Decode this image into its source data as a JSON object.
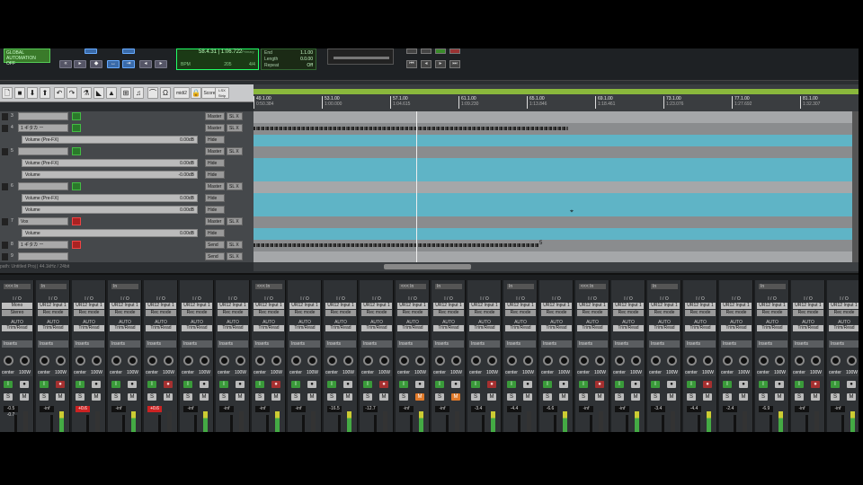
{
  "transport": {
    "automation_label": "GLOBAL AUTOMATION",
    "automation_state": "OFF",
    "counter": "58.4.31 | 1:06.722",
    "counter_mode": "Primary",
    "bpm_label": "BPM",
    "bpm_value": "205",
    "meter_value": "4/4",
    "end_label": "End",
    "end_value": "1.1.00",
    "length_label": "Length",
    "length_value": "0.0.00",
    "repeat_label": "Repeat",
    "repeat_value": "Off"
  },
  "toolbar": {
    "icons": [
      "new-doc-icon",
      "save-icon",
      "import-icon",
      "export-icon",
      "undo-icon",
      "redo-icon",
      "flask-icon",
      "mute-icon",
      "palette-icon",
      "grid-icon",
      "tempo-icon",
      "magnet-icon",
      "midi-icon",
      "lock-icon"
    ],
    "midi_label": "midi2",
    "score_label": "Score",
    "lsx_label": "LSX Strip"
  },
  "ruler": {
    "marks": [
      {
        "bar": "49.1.00",
        "time": "0:50.384"
      },
      {
        "bar": "53.1.00",
        "time": "1:00.000"
      },
      {
        "bar": "57.1.00",
        "time": "1:04.615"
      },
      {
        "bar": "61.1.00",
        "time": "1:09.230"
      },
      {
        "bar": "65.1.00",
        "time": "1:13.846"
      },
      {
        "bar": "69.1.00",
        "time": "1:18.461"
      },
      {
        "bar": "73.1.00",
        "time": "1:23.076"
      },
      {
        "bar": "77.1.00",
        "time": "1:27.692"
      },
      {
        "bar": "81.1.00",
        "time": "1:32.307"
      }
    ]
  },
  "tracks": [
    {
      "num": "3",
      "name": "",
      "mode": "Master",
      "sl": "SL X",
      "color": "green"
    },
    {
      "num": "4",
      "name": "1 ギタカ ー",
      "mode": "Master",
      "sl": "SL X",
      "color": "green"
    },
    {
      "sub": "Volume (Pre-FX)",
      "db": "0.00dB",
      "mode": "Hide"
    },
    {
      "num": "5",
      "name": "",
      "mode": "Master",
      "sl": "SL X",
      "color": "green"
    },
    {
      "sub": "Volume (Pre-FX)",
      "db": "0.00dB",
      "mode": "Hide"
    },
    {
      "sub": "Volume",
      "db": "-0.00dB",
      "mode": "Hide"
    },
    {
      "num": "6",
      "name": "",
      "mode": "Master",
      "sl": "SL X",
      "color": "green"
    },
    {
      "sub": "Volume (Pre-FX)",
      "db": "0.00dB",
      "mode": "Hide"
    },
    {
      "sub": "Volume",
      "db": "0.00dB",
      "mode": "Hide"
    },
    {
      "num": "7",
      "name": "Vox",
      "mode": "Master",
      "sl": "SL X",
      "color": "red"
    },
    {
      "sub": "Volume",
      "db": "0.00dB",
      "mode": "Hide"
    },
    {
      "num": "8",
      "name": "1 ギタカ ー",
      "mode": "Send",
      "sl": "SL X",
      "color": "red"
    },
    {
      "num": "9",
      "name": "",
      "mode": "Send",
      "sl": "SL X",
      "color": "none"
    }
  ],
  "status_text": "path: Untitled Proj | 44.1kHz / 24bit",
  "clip_label": "5",
  "mixer": {
    "io": "I / O",
    "input": "UR12 Input 1",
    "rec": "Rec mode",
    "auto": "AUTO",
    "trim": "Trim/Read",
    "inserts": "Inserts",
    "pan": "center",
    "width": "100W",
    "first_input": "Mono",
    "first_rec": "Stereo",
    "chips": [
      "<<< In",
      "In",
      "",
      "In",
      "",
      "",
      "",
      "<<< In",
      "",
      "",
      "",
      "<<< In",
      "In",
      "",
      "In",
      "",
      "<<< In",
      "",
      "In",
      "",
      "",
      "In",
      "",
      ""
    ],
    "values": [
      "-0.5 -0.7",
      "",
      "+0.6",
      "",
      "+0.6",
      "",
      "",
      "",
      "",
      "-16.5",
      "-12.7",
      "",
      "",
      "-3.4",
      "-4.4",
      "-6.6",
      "",
      "",
      "-3.4",
      "-4.4",
      "-2.4",
      "-6.9",
      "-inf",
      ""
    ],
    "red_values": [
      2,
      4
    ]
  }
}
